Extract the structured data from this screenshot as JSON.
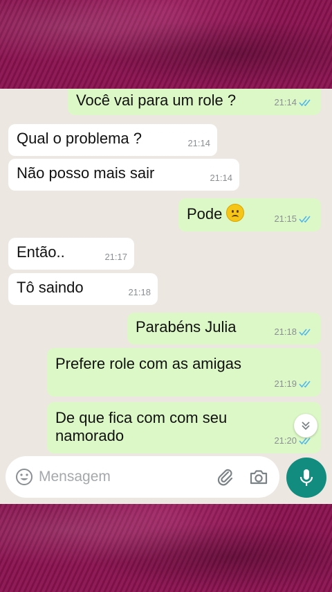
{
  "messages": [
    {
      "text": "Você vai para um role ?",
      "time": "21:14",
      "dir": "out"
    },
    {
      "text": "Qual o problema ?",
      "time": "21:14",
      "dir": "in"
    },
    {
      "text": "Não posso mais sair",
      "time": "21:14",
      "dir": "in"
    },
    {
      "text": "Pode",
      "time": "21:15",
      "dir": "out",
      "emoji": "confused-face"
    },
    {
      "text": "Então..",
      "time": "21:17",
      "dir": "in"
    },
    {
      "text": "Tô saindo",
      "time": "21:18",
      "dir": "in"
    },
    {
      "text": "Parabéns Julia",
      "time": "21:18",
      "dir": "out"
    },
    {
      "text": "Prefere role com as amigas",
      "time": "21:19",
      "dir": "out"
    },
    {
      "text": "De que fica com com seu namorado",
      "time": "21:20",
      "dir": "out"
    }
  ],
  "composer": {
    "placeholder": "Mensagem"
  },
  "icons": {
    "read_ticks": "double-check-icon",
    "scroll": "chevron-double-down-icon",
    "emoji": "smiley-icon",
    "attach": "paperclip-icon",
    "camera": "camera-icon",
    "mic": "microphone-icon"
  },
  "colors": {
    "outgoing_bubble": "#dcf8c6",
    "incoming_bubble": "#ffffff",
    "chat_background": "#ece7e1",
    "read_ticks": "#4fb6ec",
    "mic_button": "#128c7e",
    "frame": "#8a1350"
  }
}
